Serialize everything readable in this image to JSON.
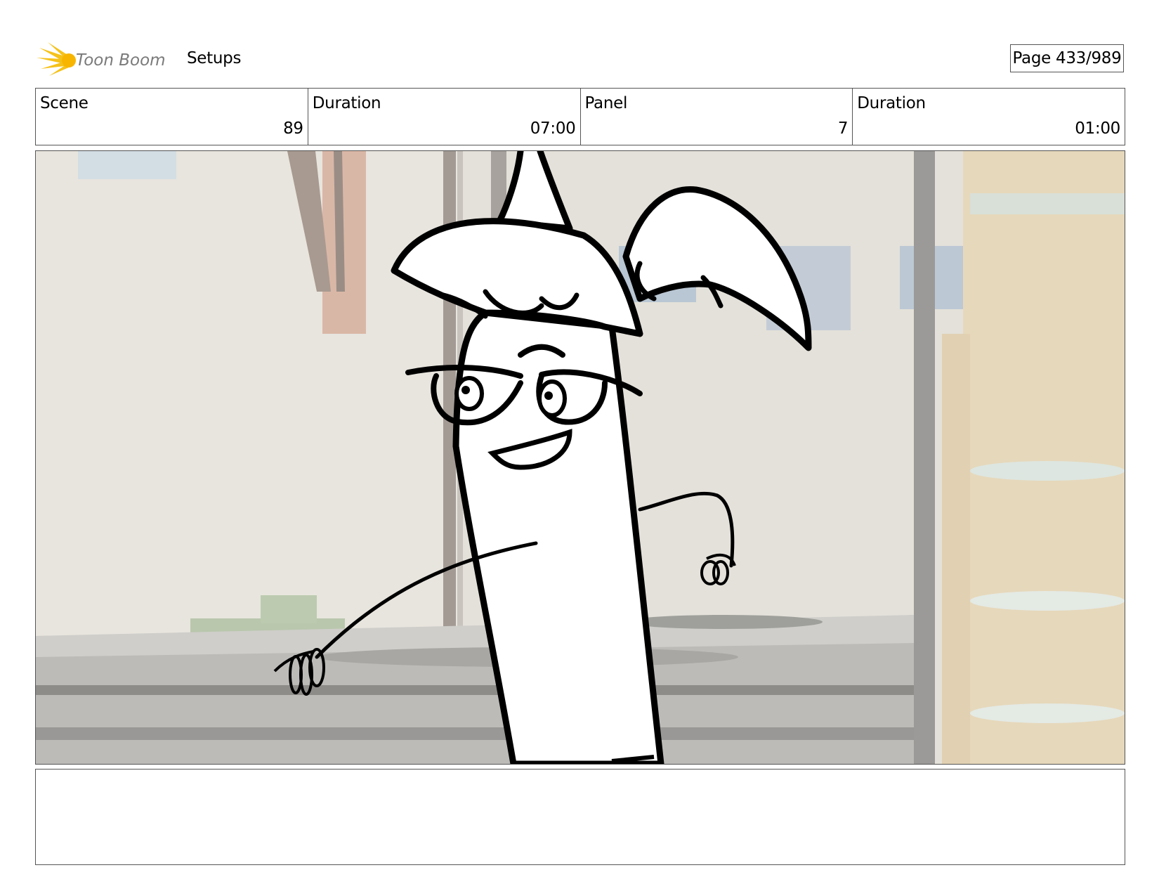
{
  "header": {
    "logo_text": "Toon Boom",
    "project_name": "Setups",
    "page_label": "Page 433/989"
  },
  "info": {
    "scene_label": "Scene",
    "scene_value": "89",
    "scene_duration_label": "Duration",
    "scene_duration_value": "07:00",
    "panel_label": "Panel",
    "panel_value": "7",
    "panel_duration_label": "Duration",
    "panel_duration_value": "01:00"
  },
  "notes": {
    "text": ""
  },
  "colors": {
    "logo_sun": "#f5c21a",
    "logo_text": "#7a7a7a",
    "border": "#555555"
  }
}
